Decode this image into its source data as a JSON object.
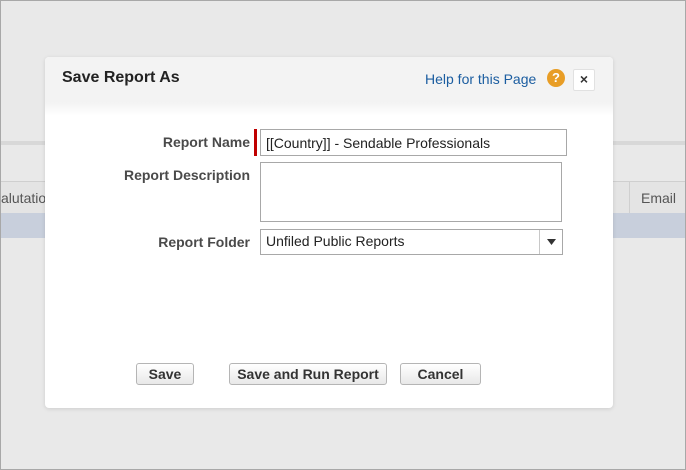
{
  "background": {
    "salutation_column_label": "alutatio",
    "email_column_label": "Email"
  },
  "dialog": {
    "title": "Save Report As",
    "help_link": "Help for this Page",
    "help_icon_glyph": "?",
    "close_glyph": "×",
    "fields": {
      "report_name_label": "Report Name",
      "report_name_value": "[[Country]] - Sendable Professionals",
      "report_description_label": "Report Description",
      "report_description_value": "",
      "report_folder_label": "Report Folder",
      "report_folder_value": "Unfiled Public Reports"
    },
    "buttons": {
      "save": "Save",
      "save_and_run": "Save and Run Report",
      "cancel": "Cancel"
    }
  },
  "colors": {
    "required_indicator": "#c00000",
    "help_icon": "#e89d25",
    "link": "#1b5da0",
    "selected_row": "#c8cfdc"
  },
  "icons": {
    "help": "question-circle-icon",
    "close": "close-icon",
    "dropdown": "chevron-down-icon"
  }
}
